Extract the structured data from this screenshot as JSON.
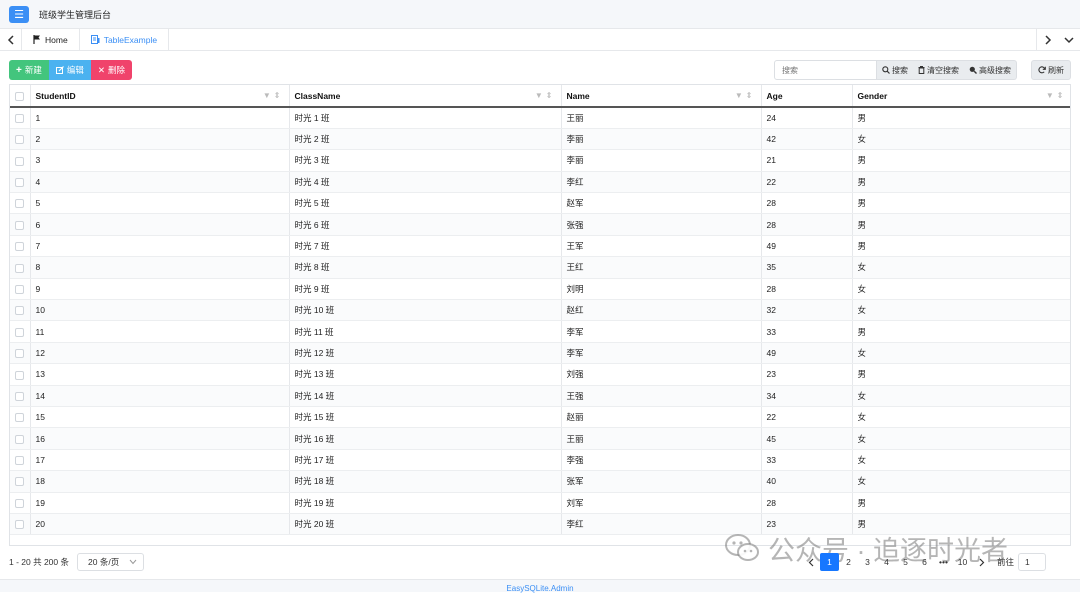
{
  "app": {
    "title": "班级学生管理后台"
  },
  "tabs": [
    {
      "label": "Home"
    },
    {
      "label": "TableExample"
    }
  ],
  "toolbar": {
    "new_label": "新建",
    "edit_label": "编辑",
    "delete_label": "删除"
  },
  "search": {
    "placeholder": "搜索",
    "search_label": "搜索",
    "clear_label": "清空搜索",
    "advanced_label": "高级搜索",
    "refresh_label": "刷新"
  },
  "table": {
    "columns": [
      "StudentID",
      "ClassName",
      "Name",
      "Age",
      "Gender"
    ],
    "rows": [
      [
        "1",
        "时光 1 班",
        "王丽",
        "24",
        "男"
      ],
      [
        "2",
        "时光 2 班",
        "李丽",
        "42",
        "女"
      ],
      [
        "3",
        "时光 3 班",
        "李丽",
        "21",
        "男"
      ],
      [
        "4",
        "时光 4 班",
        "李红",
        "22",
        "男"
      ],
      [
        "5",
        "时光 5 班",
        "赵军",
        "28",
        "男"
      ],
      [
        "6",
        "时光 6 班",
        "张强",
        "28",
        "男"
      ],
      [
        "7",
        "时光 7 班",
        "王军",
        "49",
        "男"
      ],
      [
        "8",
        "时光 8 班",
        "王红",
        "35",
        "女"
      ],
      [
        "9",
        "时光 9 班",
        "刘明",
        "28",
        "女"
      ],
      [
        "10",
        "时光 10 班",
        "赵红",
        "32",
        "女"
      ],
      [
        "11",
        "时光 11 班",
        "李军",
        "33",
        "男"
      ],
      [
        "12",
        "时光 12 班",
        "李军",
        "49",
        "女"
      ],
      [
        "13",
        "时光 13 班",
        "刘强",
        "23",
        "男"
      ],
      [
        "14",
        "时光 14 班",
        "王强",
        "34",
        "女"
      ],
      [
        "15",
        "时光 15 班",
        "赵丽",
        "22",
        "女"
      ],
      [
        "16",
        "时光 16 班",
        "王丽",
        "45",
        "女"
      ],
      [
        "17",
        "时光 17 班",
        "李强",
        "33",
        "女"
      ],
      [
        "18",
        "时光 18 班",
        "张军",
        "40",
        "女"
      ],
      [
        "19",
        "时光 19 班",
        "刘军",
        "28",
        "男"
      ],
      [
        "20",
        "时光 20 班",
        "李红",
        "23",
        "男"
      ]
    ]
  },
  "footer": {
    "summary": "1 - 20 共 200 条",
    "page_size": "20 条/页",
    "pages": [
      "1",
      "2",
      "3",
      "4",
      "5",
      "6",
      "•••",
      "10"
    ],
    "current_page": "1",
    "goto_label": "前往",
    "goto_value": "1"
  },
  "watermark": "公众号 · 追逐时光者",
  "bottom": {
    "text": "EasySQLite.Admin"
  },
  "colors": {
    "primary": "#3b8ff5",
    "new": "#43c57d",
    "edit": "#4bb2f0",
    "delete": "#f0436b",
    "page_active": "#1677ff"
  },
  "icons": {
    "menu": "menu-icon",
    "home": "flag-icon",
    "table_tab": "table-icon",
    "new": "plus-icon",
    "edit": "edit-icon",
    "delete": "close-icon",
    "search": "search-icon",
    "clear": "trash-icon",
    "advanced": "zoom-icon",
    "refresh": "refresh-icon"
  }
}
